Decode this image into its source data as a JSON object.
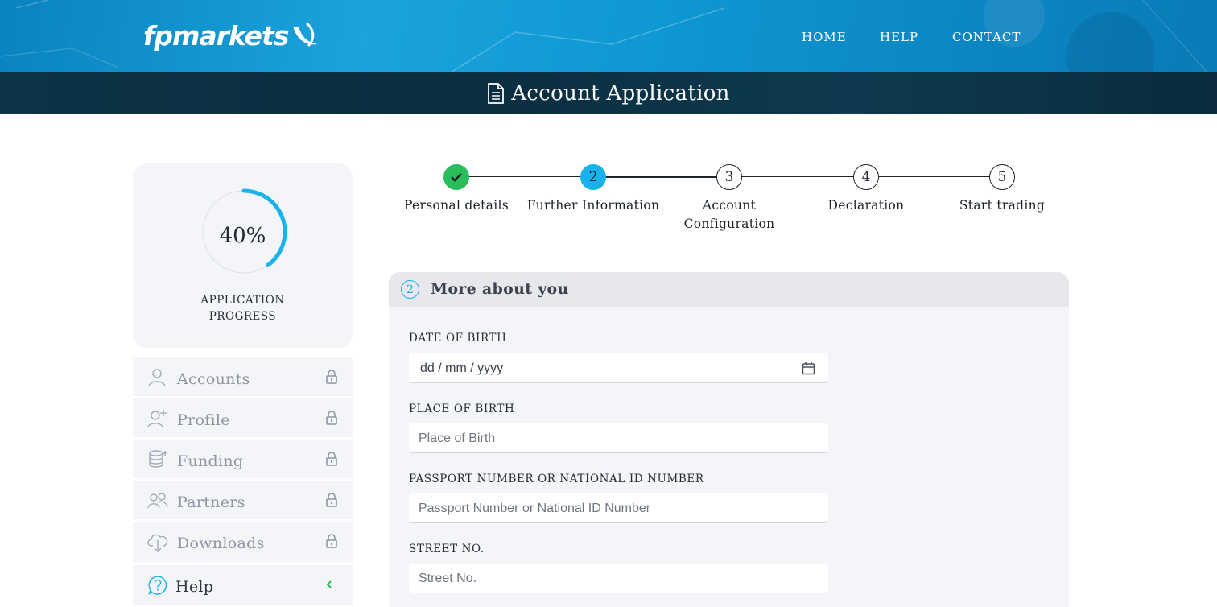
{
  "header": {
    "logo_text": "fpmarkets",
    "nav": [
      {
        "label": "HOME"
      },
      {
        "label": "HELP"
      },
      {
        "label": "CONTACT"
      }
    ],
    "page_title": "Account Application"
  },
  "progress": {
    "percent_label": "40%",
    "percent_value": 40,
    "caption_line1": "APPLICATION",
    "caption_line2": "PROGRESS",
    "color": "#19b2ea"
  },
  "sidebar": {
    "items": [
      {
        "label": "Accounts",
        "icon": "user-icon",
        "locked": true
      },
      {
        "label": "Profile",
        "icon": "user-plus-icon",
        "locked": true
      },
      {
        "label": "Funding",
        "icon": "coins-icon",
        "locked": true
      },
      {
        "label": "Partners",
        "icon": "users-icon",
        "locked": true
      },
      {
        "label": "Downloads",
        "icon": "cloud-download-icon",
        "locked": true
      },
      {
        "label": "Help",
        "icon": "question-bubble-icon",
        "locked": false
      }
    ]
  },
  "stepper": {
    "steps": [
      {
        "number": "",
        "label_line1": "Personal details",
        "label_line2": "",
        "state": "done"
      },
      {
        "number": "2",
        "label_line1": "Further Information",
        "label_line2": "",
        "state": "active"
      },
      {
        "number": "3",
        "label_line1": "Account",
        "label_line2": "Configuration",
        "state": "pending"
      },
      {
        "number": "4",
        "label_line1": "Declaration",
        "label_line2": "",
        "state": "pending"
      },
      {
        "number": "5",
        "label_line1": "Start trading",
        "label_line2": "",
        "state": "pending"
      }
    ],
    "colors": {
      "done": "#2bbc5c",
      "active": "#19b2ea"
    }
  },
  "form": {
    "section_number": "2",
    "section_title": "More about you",
    "fields": {
      "dob": {
        "label": "DATE OF BIRTH",
        "value": "dd / mm / yyyy"
      },
      "pob": {
        "label": "PLACE OF BIRTH",
        "placeholder": "Place of Birth"
      },
      "passport": {
        "label": "PASSPORT NUMBER OR NATIONAL ID NUMBER",
        "placeholder": "Passport Number or National ID Number"
      },
      "street": {
        "label": "STREET NO.",
        "placeholder": "Street No."
      }
    }
  }
}
